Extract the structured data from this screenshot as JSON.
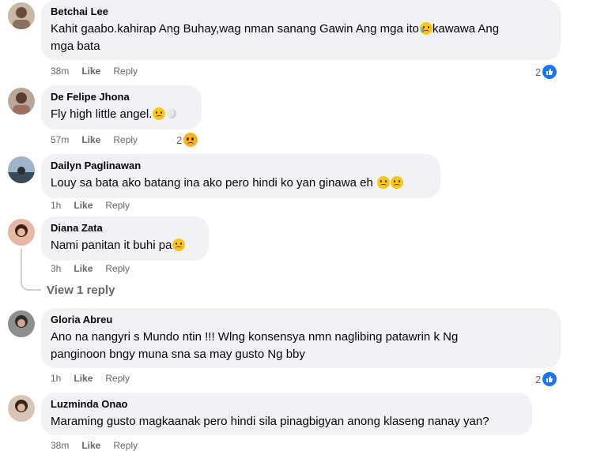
{
  "comments": [
    {
      "author": "Betchai Lee",
      "text_line1": "Kahit gaabo.kahirap Ang Buhay,wag nman sanang Gawin Ang mga ito",
      "text_line1b": "kawawa Ang",
      "text_line2": "mga bata",
      "time": "38m",
      "like": "Like",
      "reply": "Reply",
      "react_count": "2"
    },
    {
      "author": "De Felipe Jhona",
      "text": "Fly high little angel.",
      "time": "57m",
      "like": "Like",
      "reply": "Reply",
      "react_count": "2"
    },
    {
      "author": "Dailyn Paglinawan",
      "text": "Louy sa bata ako batang ina ako pero hindi ko yan ginawa eh",
      "time": "1h",
      "like": "Like",
      "reply": "Reply"
    },
    {
      "author": "Diana Zata",
      "text": "Nami panitan it buhi pa",
      "time": "3h",
      "like": "Like",
      "reply": "Reply"
    },
    {
      "author": "Gloria Abreu",
      "text_line1": "Ano na nangyri s Mundo ntin !!! Wlng konsensya nmn naglibing patawrin k Ng",
      "text_line2": "panginoon bngy muna sna sa may gusto Ng bby",
      "time": "1h",
      "like": "Like",
      "reply": "Reply",
      "react_count": "2"
    },
    {
      "author": "Luzminda Onao",
      "text": "Maraming gusto magkaanak pero hindi sila pinagbigyan anong klaseng nanay yan?",
      "time": "38m",
      "like": "Like",
      "reply": "Reply"
    }
  ],
  "view_replies": "View 1 reply",
  "colors": {
    "bubble": "#f0f2f5",
    "like_blue": "#1877f2",
    "meta": "#65676b"
  }
}
